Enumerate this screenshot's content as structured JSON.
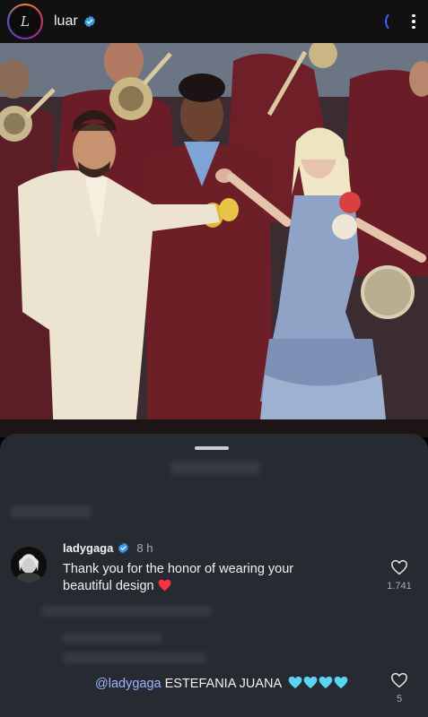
{
  "header": {
    "avatar_letter": "L",
    "username": "luar",
    "verified": true
  },
  "photo": {
    "description_icon": "photo-icon"
  },
  "comments": [
    {
      "username": "ladygaga",
      "verified": true,
      "time": "8 h",
      "text": "Thank you for the honor of wearing your beautiful design",
      "emoji": "red-heart",
      "likes": "1.741"
    },
    {
      "mention": "@ladygaga",
      "text": "ESTEFANIA JUANA",
      "emoji_count": 4,
      "emoji": "light-blue-heart",
      "likes": "5"
    }
  ],
  "colors": {
    "background": "#262a31",
    "header": "#111111",
    "verified": "#3897f0",
    "mention": "#9db4ff",
    "red_heart": "#ff3040",
    "blue_heart": "#5ad4f0"
  }
}
